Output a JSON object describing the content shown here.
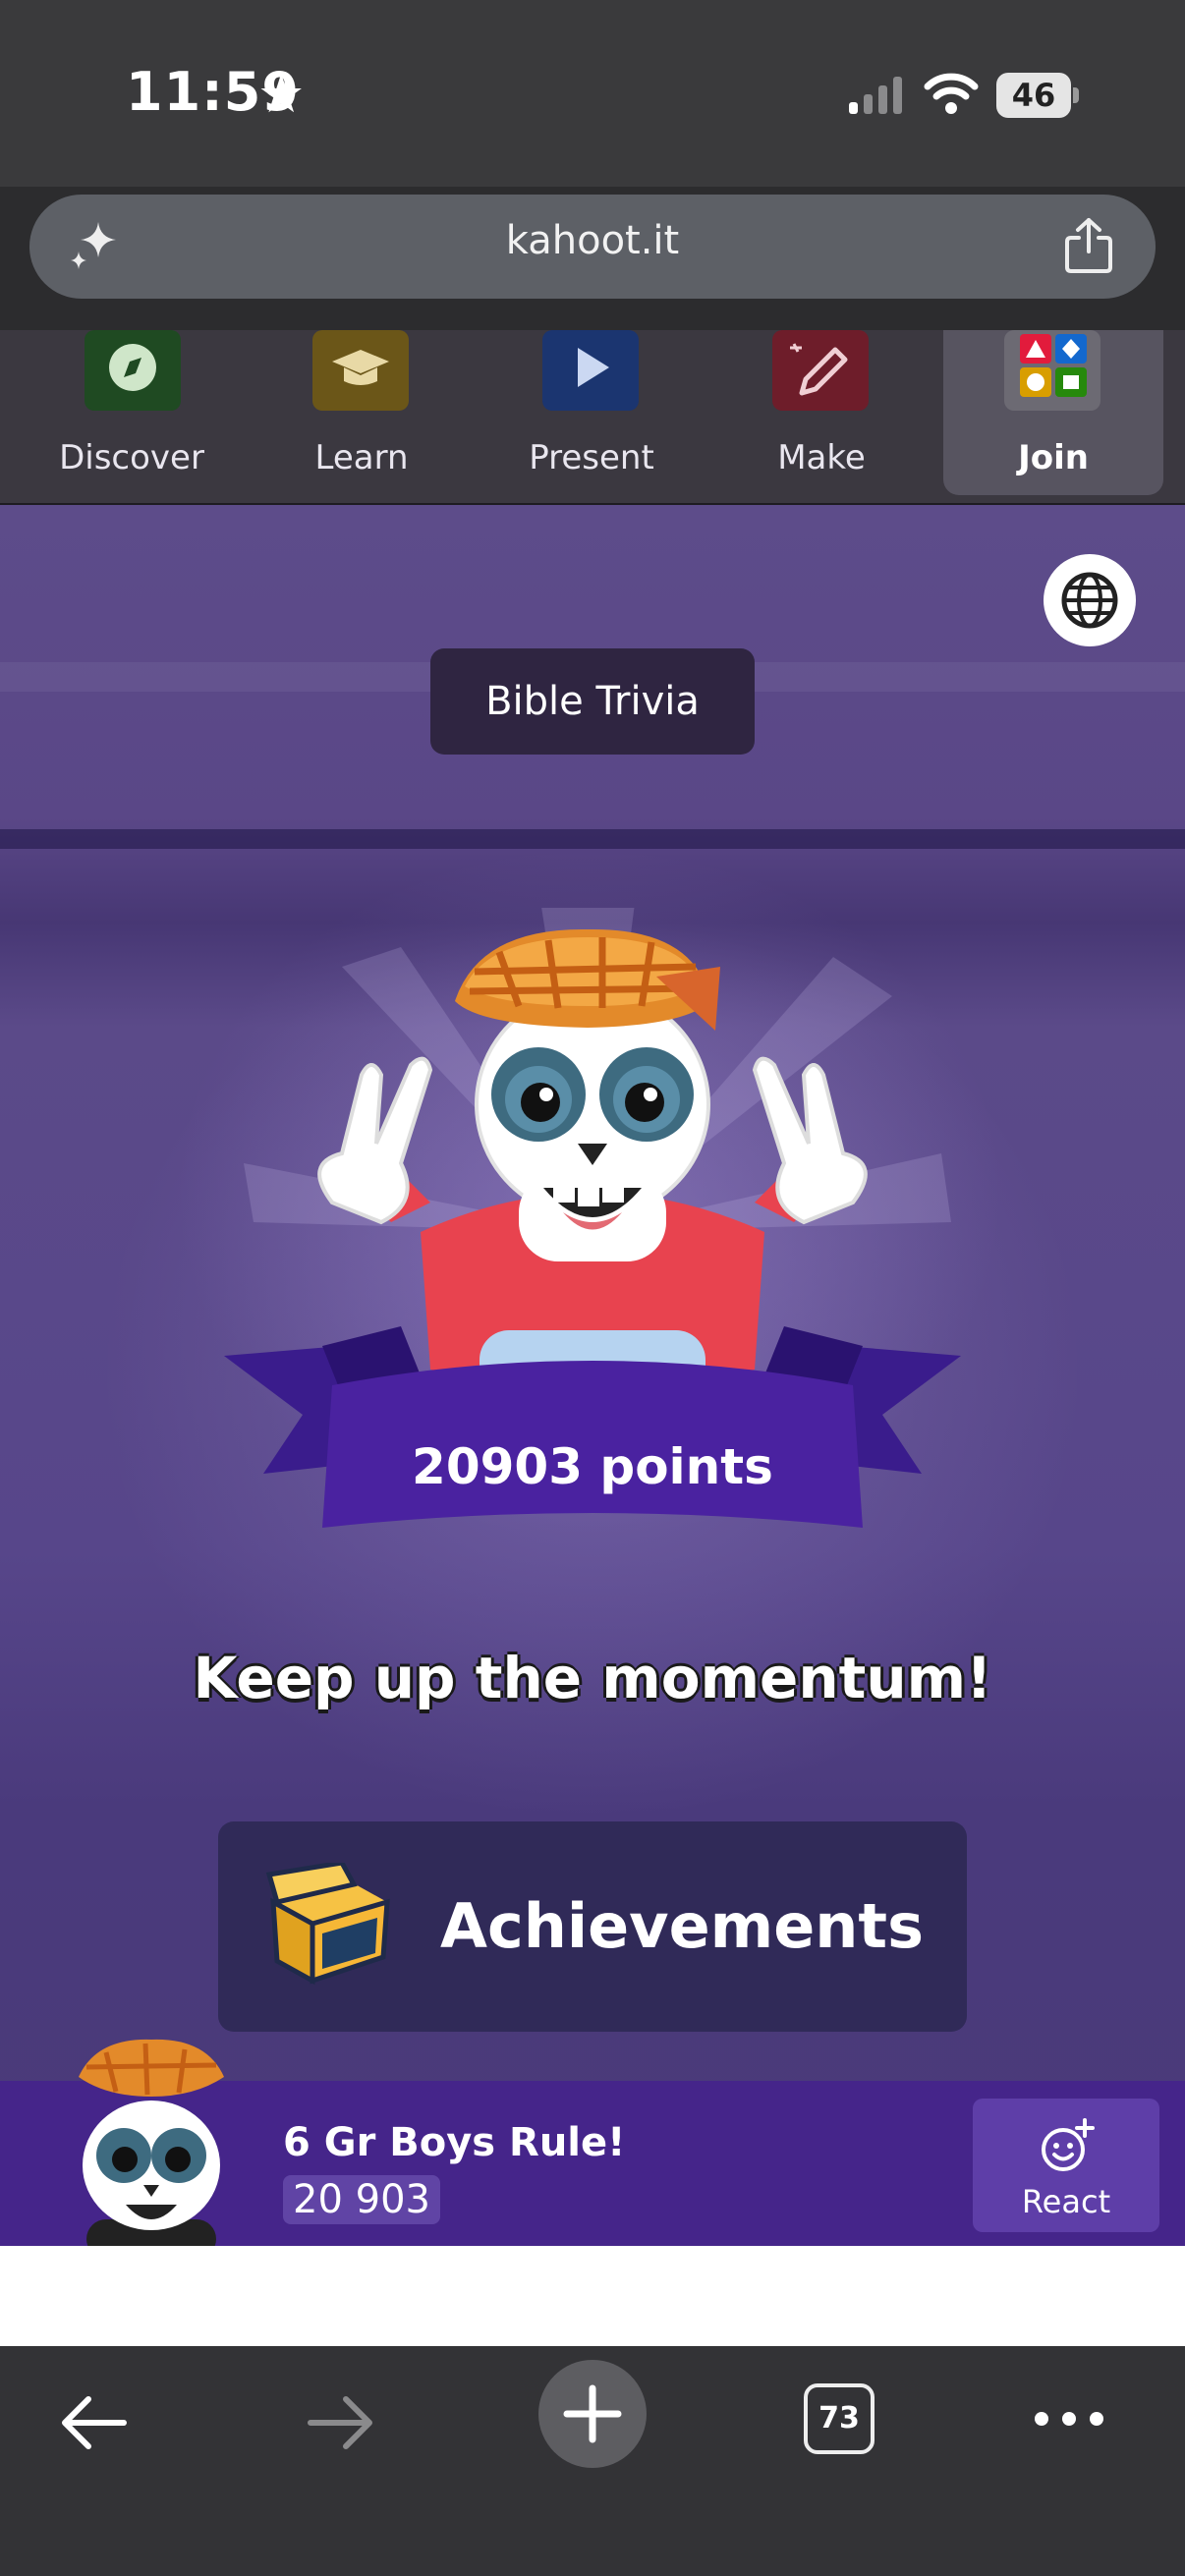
{
  "status_bar": {
    "time": "11:59",
    "battery": "46"
  },
  "browser": {
    "url": "kahoot.it"
  },
  "nav_tabs": [
    {
      "label": "Discover",
      "icon": "compass-icon",
      "color": "#1f4a22"
    },
    {
      "label": "Learn",
      "icon": "graduation-cap-icon",
      "color": "#6b5618"
    },
    {
      "label": "Present",
      "icon": "play-icon",
      "color": "#1b3570"
    },
    {
      "label": "Make",
      "icon": "pencil-icon",
      "color": "#6e1d2a"
    },
    {
      "label": "Join",
      "icon": "shapes-grid-icon",
      "color": "#6c6a73",
      "active": true
    }
  ],
  "game": {
    "quiz_title": "Bible Trivia",
    "points": "20903 points",
    "message": "Keep up the momentum!",
    "achievements_label": "Achievements"
  },
  "player": {
    "name": "6 Gr Boys Rule!",
    "score": "20 903",
    "react_label": "React"
  },
  "toolbar": {
    "tab_count": "73"
  },
  "colors": {
    "game_bg": "#57468a",
    "banner": "#4a22a0",
    "player_bar": "#45258a"
  }
}
